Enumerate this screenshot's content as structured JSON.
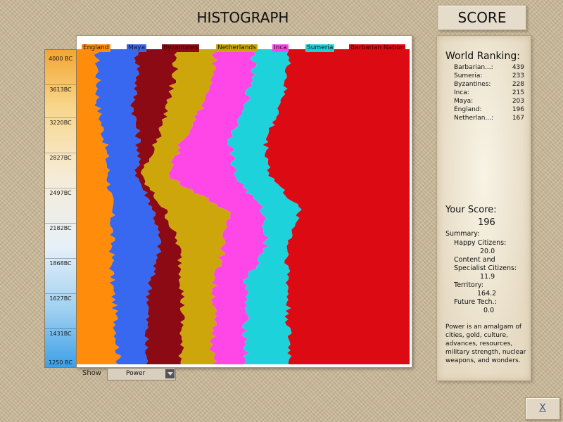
{
  "header": {
    "histograph_title": "HISTOGRAPH",
    "score_tab": "SCORE"
  },
  "timeline": {
    "labels": [
      "4000 BC",
      "3613BC",
      "3220BC",
      "2827BC",
      "2497BC",
      "2182BC",
      "1868BC",
      "1627BC",
      "1431BC",
      "1250 BC"
    ]
  },
  "legend": [
    {
      "name": "England",
      "color": "#ff8c0a"
    },
    {
      "name": "Maya",
      "color": "#3868f0"
    },
    {
      "name": "Byzantines",
      "color": "#8c0a14"
    },
    {
      "name": "Netherlands",
      "color": "#cca60a"
    },
    {
      "name": "Inca",
      "color": "#ff46e6"
    },
    {
      "name": "Sumeria",
      "color": "#1ed2dc"
    },
    {
      "name": "Barbarian Nation",
      "color": "#dc0a12"
    }
  ],
  "controls": {
    "show_label": "Show",
    "show_value": "Power"
  },
  "world_ranking": {
    "title": "World Ranking:",
    "rows": [
      {
        "name": "Barbarian...:",
        "value": "439"
      },
      {
        "name": "Sumeria:",
        "value": "233"
      },
      {
        "name": "Byzantines:",
        "value": "228"
      },
      {
        "name": "Inca:",
        "value": "215"
      },
      {
        "name": "Maya:",
        "value": "203"
      },
      {
        "name": "England:",
        "value": "196"
      },
      {
        "name": "Netherlan...:",
        "value": "167"
      }
    ]
  },
  "your_score": {
    "title": "Your Score:",
    "value": "196",
    "summary_label": "Summary:",
    "happy_label": "Happy Citizens:",
    "happy_value": "20.0",
    "content_label_1": "Content and",
    "content_label_2": "Specialist Citizens:",
    "content_value": "11.9",
    "territory_label": "Territory:",
    "territory_value": "164.2",
    "future_label": "Future Tech.:",
    "future_value": "0.0"
  },
  "power_description": "Power is an amalgam of cities, gold, culture, advances, resources, military strength, nuclear weapons, and wonders.",
  "close_button": "X"
}
